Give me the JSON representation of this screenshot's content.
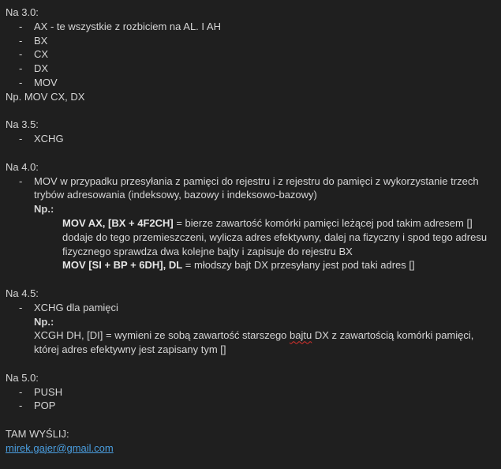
{
  "sections": {
    "s30": {
      "heading": "Na 3.0:",
      "items": [
        "AX - te wszystkie z rozbiciem na AL. I AH",
        "BX",
        "CX",
        "DX",
        "MOV"
      ],
      "example": "Np. MOV CX, DX"
    },
    "s35": {
      "heading": "Na 3.5:",
      "items": [
        "XCHG"
      ]
    },
    "s40": {
      "heading": "Na 4.0:",
      "item": "MOV w przypadku przesyłania z pamięci do rejestru i z rejestru do pamięci z wykorzystanie trzech trybów adresowania (indeksowy, bazowy i indeksowo-bazowy)",
      "np_label": "Np.:",
      "ex1_bold": "MOV AX, [BX + 4F2CH]",
      "ex1_text": " = bierze zawartość komórki pamięci leżącej pod takim adresem [] dodaje do tego przemieszczeni, wylicza adres efektywny, dalej na fizyczny i spod tego adresu fizycznego sprawdza dwa kolejne bajty i zapisuje do rejestru BX",
      "ex2_bold": "MOV [SI + BP + 6DH], DL",
      "ex2_text": " = młodszy bajt DX przesyłany jest pod taki adres []"
    },
    "s45": {
      "heading": "Na 4.5:",
      "item": "XCHG dla pamięci",
      "np_label": "Np.:",
      "ex_before": "XCGH DH, [DI] = wymieni ze sobą zawartość starszego ",
      "ex_spell": "bajtu",
      "ex_after": " DX z zawartością komórki pamięci, której adres efektywny jest zapisany tym []"
    },
    "s50": {
      "heading": "Na 5.0:",
      "items": [
        "PUSH",
        "POP"
      ]
    }
  },
  "footer": {
    "label": "TAM WYŚLIJ:",
    "email": "mirek.gajer@gmail.com"
  },
  "colors": {
    "background": "#1f1f1f",
    "text": "#d6d6d6",
    "link": "#4a9ee0",
    "spellcheck": "#d9302c"
  }
}
